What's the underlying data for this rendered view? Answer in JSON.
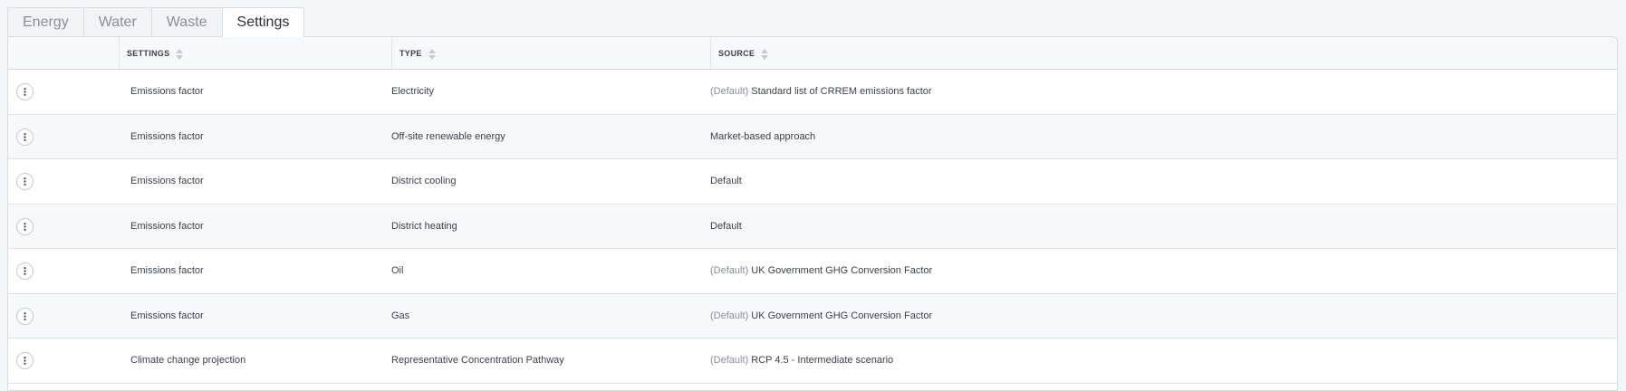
{
  "tabs": [
    {
      "label": "Energy",
      "active": false
    },
    {
      "label": "Water",
      "active": false
    },
    {
      "label": "Waste",
      "active": false
    },
    {
      "label": "Settings",
      "active": true
    }
  ],
  "table": {
    "columns": [
      "SETTINGS",
      "TYPE",
      "SOURCE"
    ],
    "rows": [
      {
        "settings": "Emissions factor",
        "type": "Electricity",
        "source_prefix": "(Default)",
        "source": "Standard list of CRREM emissions factor"
      },
      {
        "settings": "Emissions factor",
        "type": "Off-site renewable energy",
        "source_prefix": "",
        "source": "Market-based approach"
      },
      {
        "settings": "Emissions factor",
        "type": "District cooling",
        "source_prefix": "",
        "source": "Default"
      },
      {
        "settings": "Emissions factor",
        "type": "District heating",
        "source_prefix": "",
        "source": "Default"
      },
      {
        "settings": "Emissions factor",
        "type": "Oil",
        "source_prefix": "(Default)",
        "source": "UK Government GHG Conversion Factor"
      },
      {
        "settings": "Emissions factor",
        "type": "Gas",
        "source_prefix": "(Default)",
        "source": "UK Government GHG Conversion Factor"
      },
      {
        "settings": "Climate change projection",
        "type": "Representative Concentration Pathway",
        "source_prefix": "(Default)",
        "source": "RCP 4.5 - Intermediate scenario"
      }
    ]
  },
  "icons": {
    "row_menu": "kebab-menu-icon",
    "sort": "sort-icon"
  },
  "colors": {
    "accent_muted": "#8a8e99",
    "border": "#d9dce3",
    "row_alt": "#f7f8fa"
  }
}
